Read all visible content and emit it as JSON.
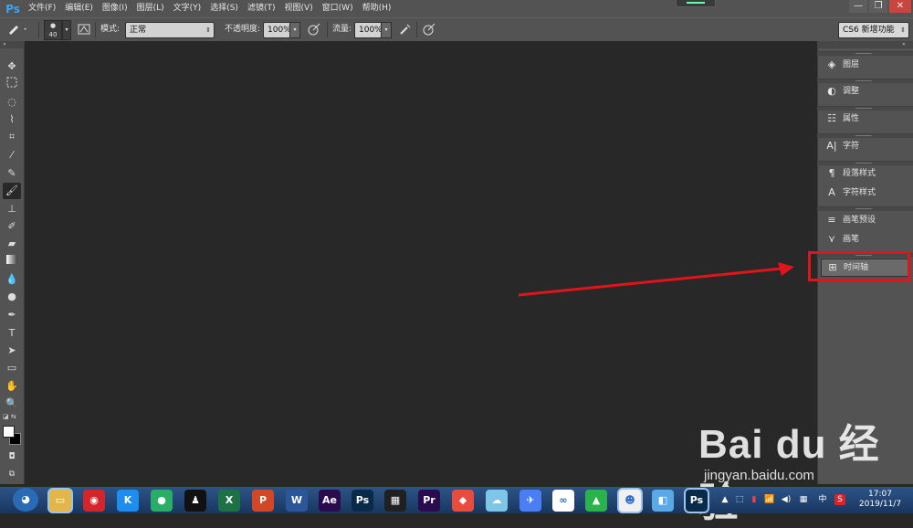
{
  "app": {
    "logo": "Ps"
  },
  "menu": [
    "文件(F)",
    "编辑(E)",
    "图像(I)",
    "图层(L)",
    "文字(Y)",
    "选择(S)",
    "滤镜(T)",
    "视图(V)",
    "窗口(W)",
    "帮助(H)"
  ],
  "window_controls": {
    "minimize": "—",
    "restore": "❐",
    "close": "✕"
  },
  "options_bar": {
    "brush_size": "40",
    "mode_label": "模式:",
    "mode_value": "正常",
    "opacity_label": "不透明度:",
    "opacity_value": "100%",
    "flow_label": "流量:",
    "flow_value": "100%",
    "workspace": "CS6 新增功能"
  },
  "tools": [
    "move-tool",
    "marquee-tool",
    "lasso-tool",
    "quick-select-tool",
    "crop-tool",
    "eyedropper-tool",
    "healing-brush-tool",
    "brush-tool",
    "clone-stamp-tool",
    "history-brush-tool",
    "eraser-tool",
    "gradient-tool",
    "blur-tool",
    "dodge-tool",
    "pen-tool",
    "type-tool",
    "path-select-tool",
    "rectangle-tool",
    "hand-tool",
    "zoom-tool"
  ],
  "right_panel": {
    "items": [
      {
        "label": "图层",
        "icon": "layers-icon"
      },
      {
        "label": "调整",
        "icon": "adjustments-icon"
      },
      {
        "label": "属性",
        "icon": "properties-icon"
      },
      {
        "label": "字符",
        "icon": "character-icon"
      },
      {
        "label": "段落样式",
        "icon": "paragraph-styles-icon"
      },
      {
        "label": "字符样式",
        "icon": "character-styles-icon"
      },
      {
        "label": "画笔预设",
        "icon": "brush-presets-icon"
      },
      {
        "label": "画笔",
        "icon": "brush-icon"
      },
      {
        "label": "时间轴",
        "icon": "timeline-icon"
      }
    ]
  },
  "taskbar": {
    "apps": [
      {
        "name": "ie",
        "glyph": "e",
        "color": "#3b8fd6"
      },
      {
        "name": "explorer",
        "glyph": "▭",
        "color": "#e3b64a"
      },
      {
        "name": "netease-music",
        "glyph": "◉",
        "color": "#d4262a"
      },
      {
        "name": "kugou",
        "glyph": "K",
        "color": "#1f8cef"
      },
      {
        "name": "wechat",
        "glyph": "●",
        "color": "#2aae67"
      },
      {
        "name": "qq",
        "glyph": "♟",
        "color": "#111111"
      },
      {
        "name": "excel",
        "glyph": "X",
        "color": "#1e7145"
      },
      {
        "name": "powerpoint",
        "glyph": "P",
        "color": "#d24726"
      },
      {
        "name": "word",
        "glyph": "W",
        "color": "#2b579a"
      },
      {
        "name": "after-effects",
        "glyph": "Ae",
        "color": "#2a0c4e"
      },
      {
        "name": "photoshop-2",
        "glyph": "Ps",
        "color": "#0a2a4a"
      },
      {
        "name": "video-editor",
        "glyph": "▦",
        "color": "#202020"
      },
      {
        "name": "premiere",
        "glyph": "Pr",
        "color": "#2a0c4e"
      },
      {
        "name": "app-red",
        "glyph": "◆",
        "color": "#e94b3c"
      },
      {
        "name": "app-cloud",
        "glyph": "☁",
        "color": "#7fc5e8"
      },
      {
        "name": "feishu",
        "glyph": "✈",
        "color": "#4b7ef5"
      },
      {
        "name": "baidu-netdisk",
        "glyph": "∞",
        "color": "#ffffff"
      },
      {
        "name": "app-green",
        "glyph": "▲",
        "color": "#2ab34a"
      },
      {
        "name": "app-face",
        "glyph": "☻",
        "color": "#f0f0f0"
      },
      {
        "name": "app-book",
        "glyph": "◧",
        "color": "#5aa9e6"
      },
      {
        "name": "photoshop",
        "glyph": "Ps",
        "color": "#0a2a4a"
      }
    ],
    "tray": [
      "▲",
      "⬚",
      "▮",
      "📶",
      "◀)",
      "▦",
      "中",
      "S"
    ],
    "time": "17:07",
    "date": "2019/11/7"
  },
  "watermark": {
    "brand": "Bai du 经验",
    "url": "jingyan.baidu.com"
  }
}
